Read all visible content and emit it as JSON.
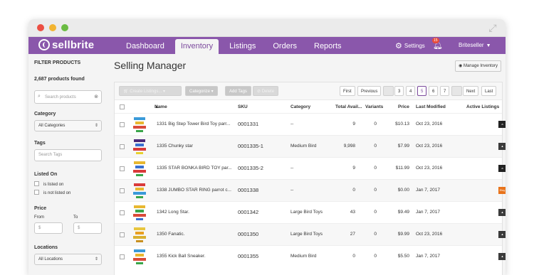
{
  "window": {
    "expand_icon": "expand-arrows-icon"
  },
  "navbar": {
    "logo": "sellbrite",
    "items": [
      {
        "label": "Dashboard"
      },
      {
        "label": "Inventory",
        "active": true
      },
      {
        "label": "Listings"
      },
      {
        "label": "Orders"
      },
      {
        "label": "Reports"
      }
    ],
    "settings": "Settings",
    "notification_count": "15",
    "user": "Briteseller"
  },
  "sidebar": {
    "heading": "FILTER PRODUCTS",
    "count": "2,687 products found",
    "search_placeholder": "Search products",
    "category_label": "Category",
    "category_value": "All Categories",
    "tags_label": "Tags",
    "tags_placeholder": "Search Tags",
    "listed_label": "Listed On",
    "listed_options": [
      "is listed on",
      "is not listed on"
    ],
    "price_label": "Price",
    "from_label": "From",
    "to_label": "To",
    "currency": "$",
    "locations_label": "Locations",
    "locations_value": "All Locations"
  },
  "main": {
    "title": "Selling Manager",
    "manage_button": "Manage Inventory",
    "toolbar": {
      "create": "Create Listings...",
      "categorize": "Categorize",
      "add_tags": "Add Tags",
      "delete": "Delete"
    },
    "pagination": {
      "first": "First",
      "previous": "Previous",
      "ellipsis": "...",
      "pages": [
        "3",
        "4",
        "5",
        "6",
        "7"
      ],
      "current": "5",
      "next": "Next",
      "last": "Last"
    },
    "columns": {
      "name": "Name",
      "sku": "SKU",
      "category": "Category",
      "total": "Total Avail...",
      "variants": "Variants",
      "price": "Price",
      "modified": "Last Modified",
      "listings": "Active Listings"
    },
    "rows": [
      {
        "name": "1331 Big Step Tower Bird Toy parr...",
        "sku": "0001331",
        "category": "--",
        "total": "9",
        "variants": "0",
        "price": "$10.13",
        "modified": "Oct 23, 2016",
        "listings": [
          "ebay",
          "etsy",
          "neutral",
          "amazon"
        ],
        "colors": [
          "#3a9ad9",
          "#e8b730",
          "#d94b3a",
          "#3aa64a"
        ]
      },
      {
        "name": "1335 Chunky star",
        "sku": "0001335-1",
        "category": "Medium Bird",
        "total": "9,998",
        "variants": "0",
        "price": "$7.99",
        "modified": "Oct 23, 2016",
        "listings": [
          "etsy",
          "neutral",
          "amazon",
          "neutral"
        ],
        "colors": [
          "#4c2a7a",
          "#3a6fd0",
          "#d93a3a",
          "#e8d130"
        ]
      },
      {
        "name": "1335 STAR BONKA BIRD TOY par...",
        "sku": "0001335-2",
        "category": "--",
        "total": "9",
        "variants": "0",
        "price": "$11.99",
        "modified": "Oct 23, 2016",
        "listings": [
          "ebay",
          "etsy",
          "amazon"
        ],
        "colors": [
          "#e8b730",
          "#3a6fd0",
          "#d93a3a",
          "#3aa64a"
        ]
      },
      {
        "name": "1338 JUMBO STAR RING parrot c...",
        "sku": "0001338",
        "category": "--",
        "total": "0",
        "variants": "0",
        "price": "$0.00",
        "modified": "Jan 7, 2017",
        "listings": [
          "etsy"
        ],
        "colors": [
          "#d93a3a",
          "#e8b730",
          "#3a9ad9",
          "#3aa64a"
        ]
      },
      {
        "name": "1342 Long Star.",
        "sku": "0001342",
        "category": "Large Bird Toys",
        "total": "43",
        "variants": "0",
        "price": "$9.49",
        "modified": "Jan 7, 2017",
        "listings": [
          "ebay",
          "neutral"
        ],
        "colors": [
          "#e8b730",
          "#3aa64a",
          "#d94b3a",
          "#3a6fd0"
        ]
      },
      {
        "name": "1350 Fanatic.",
        "sku": "0001350",
        "category": "Large Bird Toys",
        "total": "27",
        "variants": "0",
        "price": "$9.99",
        "modified": "Oct 23, 2016",
        "listings": [
          "neutral",
          "neutral",
          "neutral"
        ],
        "colors": [
          "#e8c640",
          "#e8a020",
          "#d9b030",
          "#c89020"
        ]
      },
      {
        "name": "1355 Kick Ball Sneaker.",
        "sku": "0001355",
        "category": "Medium Bird",
        "total": "0",
        "variants": "0",
        "price": "$5.50",
        "modified": "Jan 7, 2017",
        "listings": [
          "neutral",
          "amazon",
          "neutral"
        ],
        "colors": [
          "#3a9ad9",
          "#e8b730",
          "#d94b3a",
          "#3aa64a"
        ]
      }
    ]
  }
}
